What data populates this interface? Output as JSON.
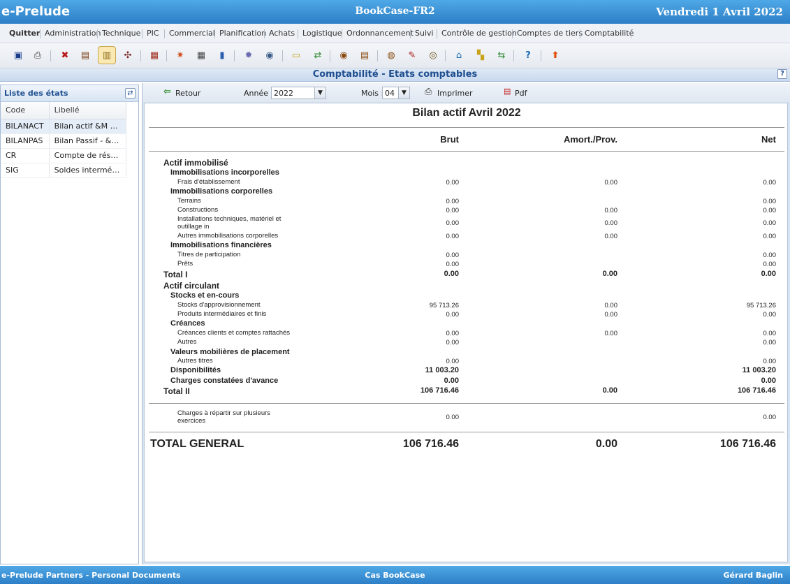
{
  "titlebar": {
    "app": "e-Prelude",
    "center": "BookCase-FR2",
    "date": "Vendredi 1 Avril 2022"
  },
  "menu": [
    "Quitter",
    "Administration",
    "Technique",
    "PIC",
    "Commercial",
    "Planification",
    "Achats",
    "Logistique",
    "Ordonnancement",
    "Suivi",
    "Contrôle de gestion",
    "Comptes de tiers",
    "Comptabilité"
  ],
  "section": {
    "title": "Comptabilité - Etats comptables",
    "help": "?"
  },
  "left": {
    "title": "Liste des états",
    "col_code": "Code",
    "col_libelle": "Libellé",
    "rows": [
      {
        "code": "BILANACT",
        "libelle": "Bilan actif &M &N"
      },
      {
        "code": "BILANPAS",
        "libelle": "Bilan Passif - &M ..."
      },
      {
        "code": "CR",
        "libelle": "Compte de résultat"
      },
      {
        "code": "SIG",
        "libelle": "Soldes intermédi..."
      }
    ]
  },
  "rtoolbar": {
    "retour": "Retour",
    "annee_label": "Année :",
    "annee_value": "2022",
    "mois_label": "Mois :",
    "mois_value": "04",
    "imprimer": "Imprimer",
    "pdf": "Pdf"
  },
  "report": {
    "title": "Bilan actif Avril 2022",
    "col_brut": "Brut",
    "col_amort": "Amort./Prov.",
    "col_net": "Net",
    "lines": [
      {
        "label": "Actif immobilisé",
        "level": 1,
        "brut": "",
        "amort": "",
        "net": ""
      },
      {
        "label": "Immobilisations incorporelles",
        "level": 2,
        "brut": "",
        "amort": "",
        "net": ""
      },
      {
        "label": "Frais d'établissement",
        "level": 3,
        "brut": "0.00",
        "amort": "0.00",
        "net": "0.00"
      },
      {
        "label": "Immobilisations corporelles",
        "level": 2,
        "brut": "",
        "amort": "",
        "net": ""
      },
      {
        "label": "Terrains",
        "level": 3,
        "brut": "0.00",
        "amort": "",
        "net": "0.00"
      },
      {
        "label": "Constructions",
        "level": 3,
        "brut": "0.00",
        "amort": "0.00",
        "net": "0.00"
      },
      {
        "label": "Installations techniques, matériel et",
        "label2": "outillage in",
        "level": 3,
        "brut": "0.00",
        "amort": "0.00",
        "net": "0.00"
      },
      {
        "label": "Autres immobilisations corporelles",
        "level": 3,
        "brut": "0.00",
        "amort": "0.00",
        "net": "0.00"
      },
      {
        "label": "Immobilisations financières",
        "level": 2,
        "brut": "",
        "amort": "",
        "net": ""
      },
      {
        "label": "Titres de participation",
        "level": 3,
        "brut": "0.00",
        "amort": "",
        "net": "0.00"
      },
      {
        "label": "Prêts",
        "level": 3,
        "brut": "0.00",
        "amort": "",
        "net": "0.00"
      },
      {
        "label": "Total I",
        "level": "t",
        "brut": "0.00",
        "amort": "0.00",
        "net": "0.00"
      },
      {
        "label": "Actif circulant",
        "level": 1,
        "brut": "",
        "amort": "",
        "net": ""
      },
      {
        "label": "Stocks et en-cours",
        "level": 2,
        "brut": "",
        "amort": "",
        "net": ""
      },
      {
        "label": "Stocks d'approvisionnement",
        "level": 3,
        "brut": "95 713.26",
        "amort": "0.00",
        "net": "95 713.26"
      },
      {
        "label": "Produits intermédiaires et finis",
        "level": 3,
        "brut": "0.00",
        "amort": "0.00",
        "net": "0.00"
      },
      {
        "label": "Créances",
        "level": 2,
        "brut": "",
        "amort": "",
        "net": ""
      },
      {
        "label": "Créances clients et comptes rattachés",
        "level": 3,
        "brut": "0.00",
        "amort": "0.00",
        "net": "0.00"
      },
      {
        "label": "Autres",
        "level": 3,
        "brut": "0.00",
        "amort": "",
        "net": "0.00"
      },
      {
        "label": "Valeurs mobilières de placement",
        "level": 2,
        "brut": "",
        "amort": "",
        "net": ""
      },
      {
        "label": "Autres titres",
        "level": 3,
        "brut": "0.00",
        "amort": "",
        "net": "0.00"
      },
      {
        "label": "Disponibilités",
        "level": "2v",
        "brut": "11 003.20",
        "amort": "",
        "net": "11 003.20"
      },
      {
        "label": "Charges constatées d'avance",
        "level": "2v",
        "brut": "0.00",
        "amort": "",
        "net": "0.00"
      },
      {
        "label": "Total II",
        "level": "t",
        "brut": "106 716.46",
        "amort": "0.00",
        "net": "106 716.46"
      }
    ],
    "charges": {
      "label": "Charges à répartir sur plusieurs",
      "label2": "exercices",
      "brut": "0.00",
      "net": "0.00"
    },
    "total_general": {
      "label": "TOTAL GENERAL",
      "brut": "106 716.46",
      "amort": "0.00",
      "net": "106 716.46"
    }
  },
  "footer": {
    "left": "e-Prelude Partners - Personal Documents",
    "center": "Cas BookCase",
    "right": "Gérard Baglin"
  }
}
